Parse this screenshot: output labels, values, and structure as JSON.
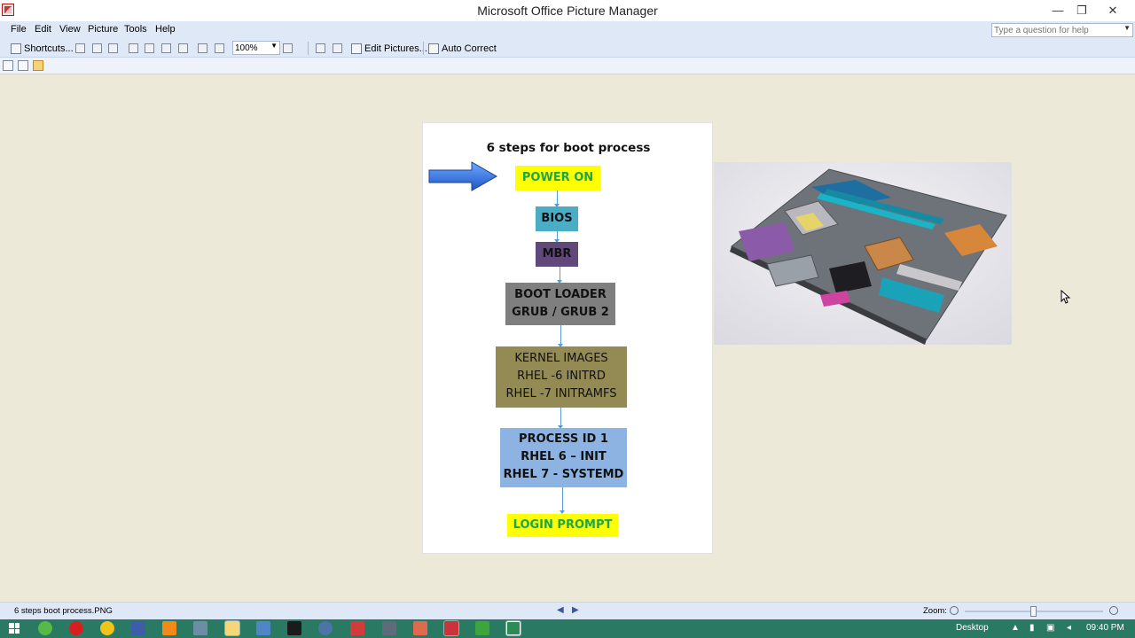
{
  "window": {
    "title": "Microsoft Office Picture Manager",
    "minimize_glyph": "—",
    "restore_glyph": "❐",
    "close_glyph": "✕"
  },
  "menu": {
    "items": [
      "File",
      "Edit",
      "View",
      "Picture",
      "Tools",
      "Help"
    ],
    "help_placeholder": "Type a question for help"
  },
  "toolbar": {
    "shortcuts_label": "Shortcuts...",
    "zoom_value": "100%",
    "edit_pictures_label": "Edit Pictures...",
    "auto_correct_label": "Auto Correct"
  },
  "diagram": {
    "title": "6 steps for boot process",
    "steps": [
      {
        "lines": [
          "POWER ON"
        ],
        "bg": "#ffff00",
        "fg": "#1aa64a"
      },
      {
        "lines": [
          "BIOS"
        ],
        "bg": "#4bacc6",
        "fg": "#111111"
      },
      {
        "lines": [
          "MBR"
        ],
        "bg": "#60497a",
        "fg": "#111111"
      },
      {
        "lines": [
          "BOOT LOADER",
          "GRUB / GRUB 2"
        ],
        "bg": "#7f7f7f",
        "fg": "#111111"
      },
      {
        "lines": [
          "KERNEL IMAGES",
          "RHEL -6 INITRD",
          "RHEL -7 INITRAMFS"
        ],
        "bg": "#948a54",
        "fg": "#111111"
      },
      {
        "lines": [
          "PROCESS ID 1",
          "RHEL 6 – INIT",
          "RHEL 7 - SYSTEMD"
        ],
        "bg": "#8db3e2",
        "fg": "#111111"
      },
      {
        "lines": [
          "LOGIN PROMPT"
        ],
        "bg": "#ffff00",
        "fg": "#1aa64a"
      }
    ],
    "pointer_arrow_color": "#2f6fd6"
  },
  "status": {
    "filename": "6 steps boot process.PNG",
    "zoom_label": "Zoom:"
  },
  "taskbar": {
    "desktop_label": "Desktop",
    "clock": "09:40 PM",
    "color": "#2a7a63"
  }
}
